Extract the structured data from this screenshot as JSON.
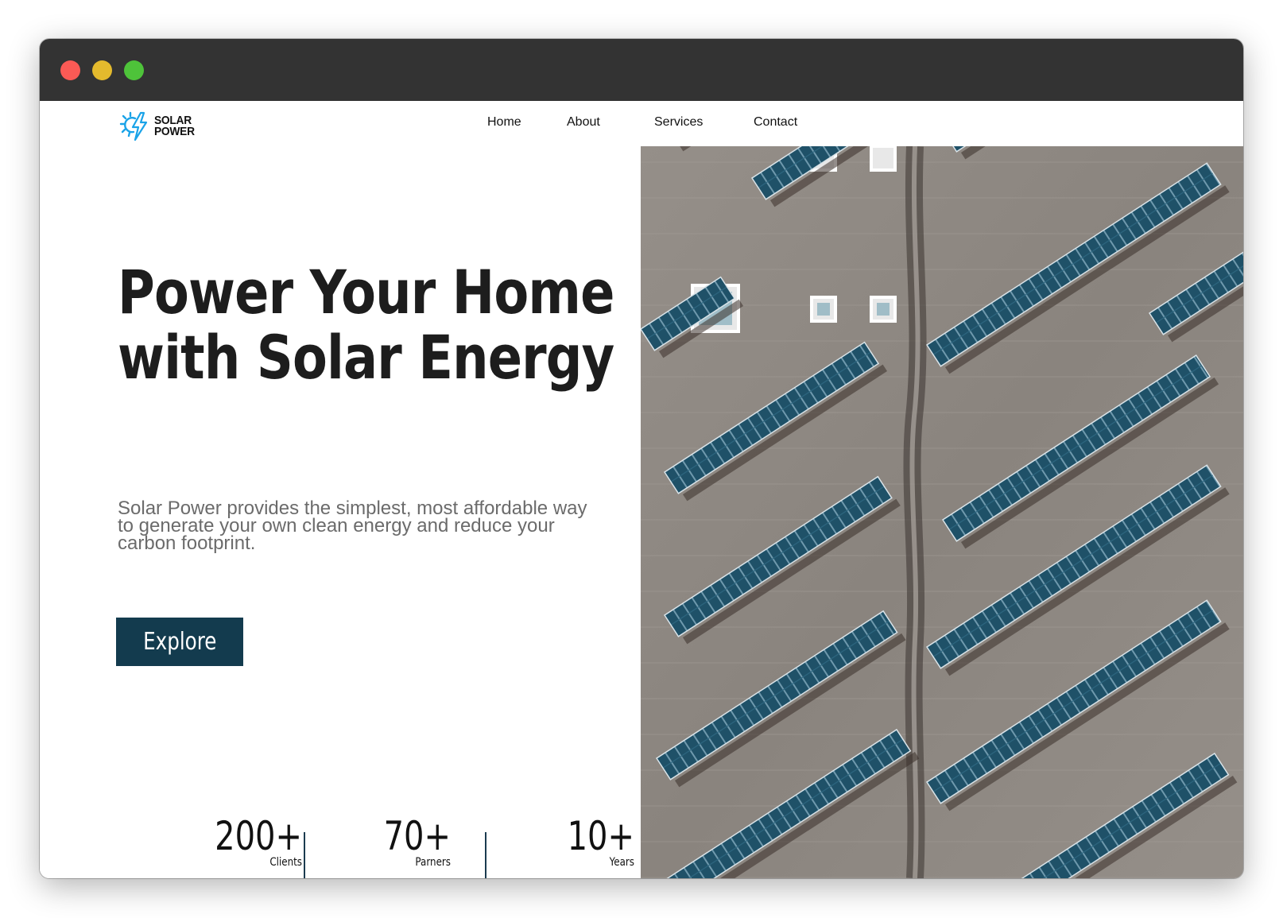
{
  "window": {
    "controls": [
      "close",
      "minimize",
      "maximize"
    ]
  },
  "brand": {
    "line1": "SOLAR",
    "line2": "POWER",
    "icon": "solar-bolt-logo-icon",
    "accent": "#1aa3e8"
  },
  "nav": {
    "items": [
      "Home",
      "About",
      "Services",
      "Contact"
    ]
  },
  "hero": {
    "headline": "Power Your Home with Solar Energy",
    "subtext": "Solar Power provides the simplest, most affordable way to generate your own clean energy and reduce your carbon footprint.",
    "cta_label": "Explore",
    "cta_color": "#133b4e"
  },
  "stats": [
    {
      "value": "200+",
      "label": "Clients"
    },
    {
      "value": "70+",
      "label": "Parners"
    },
    {
      "value": "10+",
      "label": "Years"
    }
  ],
  "image": {
    "subject": "aerial-solar-panels-rooftop"
  }
}
